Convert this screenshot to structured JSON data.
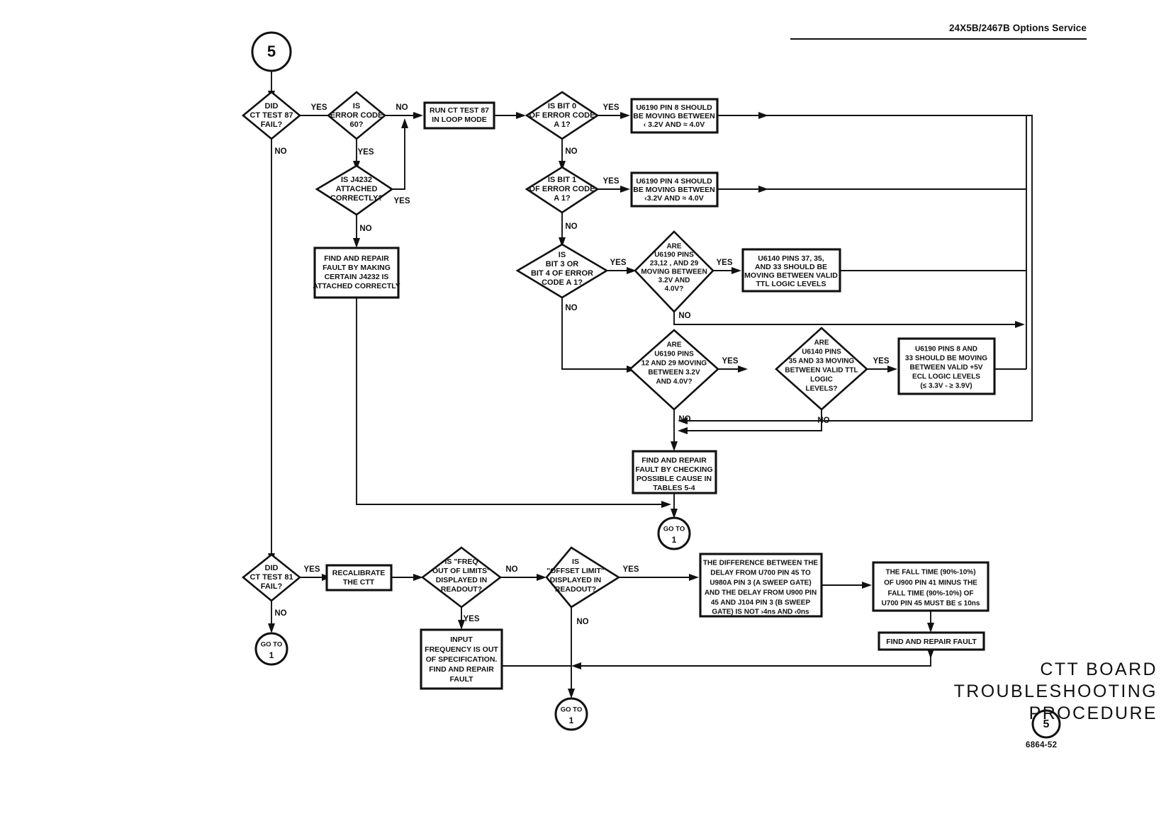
{
  "header": {
    "title": "24X5B/2467B Options Service"
  },
  "footer": {
    "title_lines": [
      "CTT BOARD",
      "TROUBLESHOOTING",
      "PROCEDURE"
    ],
    "page_marker": "5",
    "drawing_code": "6864-52"
  },
  "connectors": {
    "start_top": "5",
    "goto_label": "GO TO",
    "goto_target": "1"
  },
  "edge_labels": {
    "yes": "YES",
    "no": "NO"
  },
  "nodes": [
    {
      "id": "start5",
      "type": "connector-circle",
      "lines": [
        "5"
      ]
    },
    {
      "id": "d-ct87-fail",
      "type": "decision",
      "lines": [
        "DID",
        "CT TEST 87",
        "FAIL?"
      ]
    },
    {
      "id": "d-errcode60",
      "type": "decision",
      "lines": [
        "IS",
        "ERROR CODE",
        "60?"
      ]
    },
    {
      "id": "d-j4232",
      "type": "decision",
      "lines": [
        "IS J4232",
        "ATTACHED",
        "CORRECTLY?"
      ]
    },
    {
      "id": "p-repair-j4232",
      "type": "process",
      "lines": [
        "FIND AND REPAIR",
        "FAULT BY MAKING",
        "CERTAIN J4232 IS",
        "ATTACHED CORRECTLY"
      ]
    },
    {
      "id": "p-run-ct87-loop",
      "type": "process",
      "lines": [
        "RUN CT TEST 87",
        "IN LOOP MODE"
      ]
    },
    {
      "id": "d-bit0",
      "type": "decision",
      "lines": [
        "IS BIT 0",
        "OF ERROR CODE",
        "A 1?"
      ]
    },
    {
      "id": "p-u6190-pin8",
      "type": "process",
      "lines": [
        "U6190 PIN 8 SHOULD",
        "BE MOVING BETWEEN",
        "‹ 3.2V AND ≈ 4.0V"
      ]
    },
    {
      "id": "d-bit1",
      "type": "decision",
      "lines": [
        "IS BIT 1",
        "OF ERROR CODE",
        "A 1?"
      ]
    },
    {
      "id": "p-u6190-pin4",
      "type": "process",
      "lines": [
        "U6190 PIN 4 SHOULD",
        "BE MOVING BETWEEN",
        "‹3.2V AND  ≈ 4.0V"
      ]
    },
    {
      "id": "d-bit34",
      "type": "decision",
      "lines": [
        "IS",
        "BIT 3 OR",
        "BIT 4 OF ERROR",
        "CODE A 1?"
      ]
    },
    {
      "id": "d-u6190-23-12-29",
      "type": "decision",
      "lines": [
        "ARE",
        "U6190 PINS",
        "23,12 , AND 29",
        "MOVING BETWEEN",
        "3.2V AND",
        "4.0V?"
      ]
    },
    {
      "id": "p-u6140-37-35-33",
      "type": "process",
      "lines": [
        "U6140 PINS 37, 35,",
        "AND 33 SHOULD BE",
        "MOVING BETWEEN VALID",
        "TTL LOGIC LEVELS"
      ]
    },
    {
      "id": "d-u6190-12-29",
      "type": "decision",
      "lines": [
        "ARE",
        "U6190 PINS",
        "12 AND 29 MOVING",
        "BETWEEN 3.2V",
        "AND 4.0V?"
      ]
    },
    {
      "id": "d-u6140-35-33",
      "type": "decision",
      "lines": [
        "ARE",
        "U6140 PINS",
        "35 AND 33 MOVING",
        "BETWEEN VALID TTL",
        "LOGIC",
        "LEVELS?"
      ]
    },
    {
      "id": "p-u6190-8-33",
      "type": "process",
      "lines": [
        "U6190 PINS 8 AND",
        "33 SHOULD BE MOVING",
        "BETWEEN VALID +5V",
        "ECL LOGIC LEVELS",
        "(≤ 3.3V - ≥ 3.9V)"
      ]
    },
    {
      "id": "p-repair-tables",
      "type": "process",
      "lines": [
        "FIND AND REPAIR",
        "FAULT BY CHECKING",
        "POSSIBLE CAUSE IN",
        "TABLES 5-4"
      ]
    },
    {
      "id": "goto1-mid",
      "type": "connector-circle",
      "lines": [
        "GO TO",
        "1"
      ]
    },
    {
      "id": "d-ct81-fail",
      "type": "decision",
      "lines": [
        "DID",
        "CT TEST 81",
        "FAIL?"
      ]
    },
    {
      "id": "goto1-left",
      "type": "connector-circle",
      "lines": [
        "GO TO",
        "1"
      ]
    },
    {
      "id": "p-recalibrate",
      "type": "process",
      "lines": [
        "RECALIBRATE",
        "THE CTT"
      ]
    },
    {
      "id": "d-freq-out",
      "type": "decision",
      "lines": [
        "IS \"FREQ",
        "OUT OF LIMITS\"",
        "DISPLAYED IN",
        "READOUT?"
      ]
    },
    {
      "id": "p-input-freq",
      "type": "process",
      "lines": [
        "INPUT",
        "FREQUENCY IS OUT",
        "OF SPECIFICATION.",
        "FIND AND REPAIR",
        "FAULT"
      ]
    },
    {
      "id": "d-offset-limit",
      "type": "decision",
      "lines": [
        "IS",
        "\"OFFSET LIMIT\"",
        "DISPLAYED IN",
        "READOUT?"
      ]
    },
    {
      "id": "goto1-bottom",
      "type": "connector-circle",
      "lines": [
        "GO TO",
        "1"
      ]
    },
    {
      "id": "p-delay-diff",
      "type": "process",
      "lines": [
        "THE DIFFERENCE BETWEEN THE",
        "DELAY FROM U700 PIN 45 TO",
        "U980A PIN 3 (A SWEEP GATE)",
        "AND THE DELAY FROM U900 PIN",
        "45 AND J104 PIN 3 (B SWEEP",
        "GATE) IS NOT ›4ns AND ‹0ns"
      ]
    },
    {
      "id": "p-fall-time",
      "type": "process",
      "lines": [
        "THE FALL TIME (90%-10%)",
        "OF U900 PIN 41 MINUS THE",
        "FALL TIME (90%-10%) OF",
        "U700 PIN 45 MUST BE ≤ 10ns"
      ]
    },
    {
      "id": "p-find-repair-fault",
      "type": "process",
      "lines": [
        "FIND AND REPAIR FAULT"
      ]
    }
  ]
}
